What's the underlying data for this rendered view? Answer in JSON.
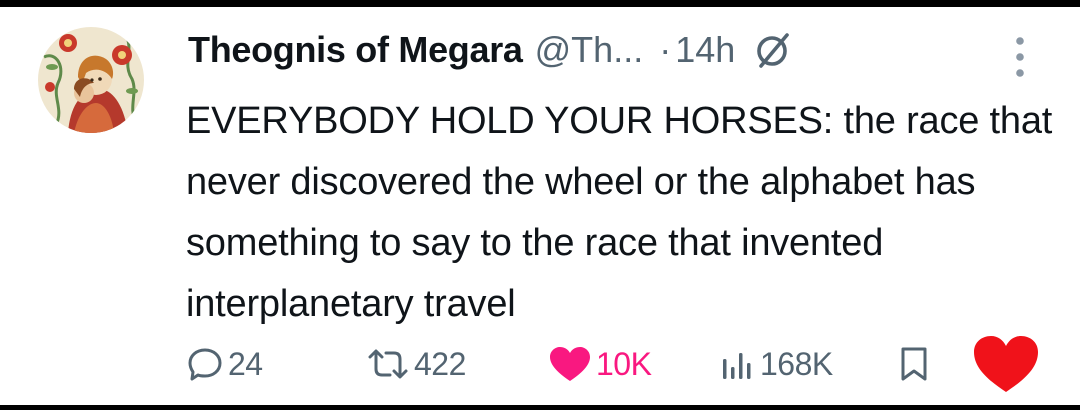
{
  "tweet": {
    "author_name": "Theognis of Megara",
    "handle": "@Th...",
    "separator": "·",
    "time": "14h",
    "text": "EVERYBODY HOLD YOUR HORSES: the race that never discovered the wheel or the alphabet has something to say to the race that invented interplanetary travel"
  },
  "actions": {
    "replies": "24",
    "reposts": "422",
    "likes": "10K",
    "views": "168K"
  },
  "icons": {
    "reply": "speech-bubble-icon",
    "repost": "repost-arrows-icon",
    "like": "heart-filled-icon",
    "views": "bar-chart-icon",
    "bookmark": "bookmark-icon",
    "reaction": "big-red-heart-icon",
    "grok": "slashed-circle-icon",
    "more": "vertical-dots-icon"
  },
  "colors": {
    "text_primary": "#0f1419",
    "text_secondary": "#536471",
    "like_pink": "#f91880",
    "reaction_red": "#f0121a"
  }
}
